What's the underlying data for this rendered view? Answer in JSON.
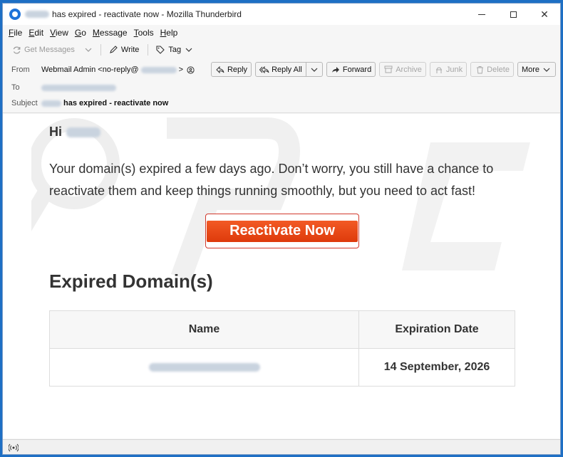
{
  "window": {
    "title_suffix": "has expired - reactivate now - Mozilla Thunderbird",
    "minimize_glyph": "",
    "close_glyph": "✕"
  },
  "menu": {
    "items": [
      "File",
      "Edit",
      "View",
      "Go",
      "Message",
      "Tools",
      "Help"
    ],
    "underline": [
      "F",
      "E",
      "V",
      "G",
      "M",
      "T",
      "H"
    ]
  },
  "toolbar": {
    "get_messages": "Get Messages",
    "write": "Write",
    "tag": "Tag"
  },
  "header": {
    "from_label": "From",
    "from_name": "Webmail Admin <no-reply@",
    "from_end": ">",
    "to_label": "To",
    "subject_label": "Subject",
    "subject_text": "has expired - reactivate now",
    "buttons": {
      "reply": "Reply",
      "reply_all": "Reply All",
      "forward": "Forward",
      "archive": "Archive",
      "junk": "Junk",
      "delete": "Delete",
      "more": "More"
    }
  },
  "body": {
    "greeting": "Hi",
    "intro": "Your domain(s) expired a few days ago. Don’t worry, you still have a chance to reactivate them and keep things running smoothly, but you need to act fast!",
    "cta": "Reactivate Now",
    "section_title": "Expired Domain(s)",
    "table": {
      "headers": [
        "Name",
        "Expiration Date"
      ],
      "rows": [
        {
          "expiration": "14 September, 2026"
        }
      ]
    }
  },
  "colors": {
    "cta_bg": "#e8441a",
    "cta_border": "#d1392c",
    "accent": "#1f73d9"
  }
}
